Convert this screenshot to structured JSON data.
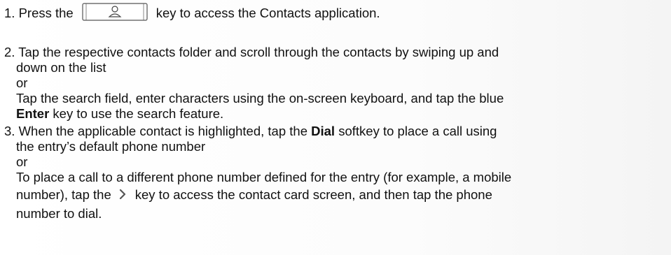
{
  "steps": [
    {
      "number": "1.",
      "before_key": "Press the",
      "key_icon": "contacts-person-icon",
      "after_key": "key to access the Contacts application."
    },
    {
      "number": "2.",
      "line1": "Tap the respective contacts folder and scroll through the contacts by swiping up and",
      "line2": "down on the list",
      "or": "or",
      "line3": "Tap the search field, enter characters using the on-screen keyboard, and tap the blue",
      "bold": "Enter",
      "line4_rest": " key to use the search feature."
    },
    {
      "number": "3.",
      "line1_pre": "When the applicable contact is highlighted, tap the ",
      "bold": "Dial",
      "line1_post": " softkey to place a call using",
      "line2": "the entry’s default phone number",
      "or": "or",
      "line3": "To place a call to a different phone number defined for the entry (for example, a mobile",
      "line4_pre": "number), tap the",
      "key_icon": "chevron-right-icon",
      "line4_post": "key to access the contact card screen, and then tap the phone",
      "line5": "number to dial."
    }
  ]
}
